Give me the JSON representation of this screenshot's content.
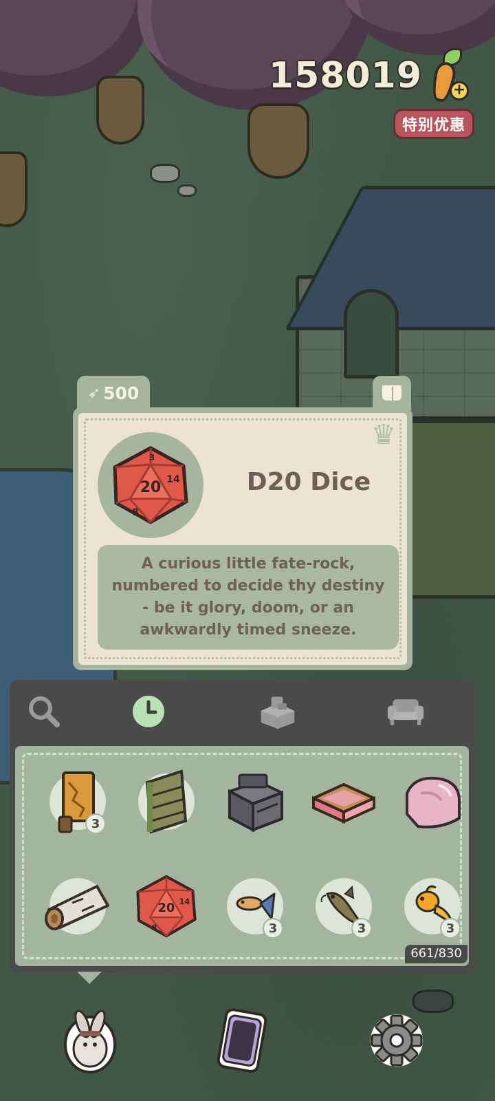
{
  "currency": {
    "amount": "158019",
    "icon": "carrot-plus-icon",
    "special_offer": "特别优惠"
  },
  "item_card": {
    "price": "500",
    "price_icon": "carrot-icon",
    "name": "D20 Dice",
    "description": "A curious little fate-rock, numbered to decide thy destiny - be it glory, doom, or an awkwardly timed sneeze.",
    "die_faces": [
      "20",
      "14",
      "8",
      "3"
    ]
  },
  "inventory": {
    "tabs": [
      {
        "icon": "magnifier-icon",
        "active": false
      },
      {
        "icon": "clock-icon",
        "active": true
      },
      {
        "icon": "appliance-icon",
        "active": false
      },
      {
        "icon": "sofa-icon",
        "active": false
      }
    ],
    "items": [
      {
        "name": "ornate-screen",
        "count": "3"
      },
      {
        "name": "wooden-shelf",
        "count": ""
      },
      {
        "name": "photocopier",
        "count": ""
      },
      {
        "name": "flower-planter",
        "count": ""
      },
      {
        "name": "pink-rock",
        "count": ""
      },
      {
        "name": "birch-log",
        "count": ""
      },
      {
        "name": "d20-dice",
        "count": ""
      },
      {
        "name": "guppy-fish",
        "count": "3"
      },
      {
        "name": "catfish",
        "count": "3"
      },
      {
        "name": "goldfish",
        "count": "3"
      }
    ],
    "capacity": "661/830"
  },
  "bottom_nav": [
    {
      "icon": "bunny-avatar-icon"
    },
    {
      "icon": "phone-icon"
    },
    {
      "icon": "settings-gear-icon"
    }
  ],
  "colors": {
    "card_frame": "#a4b49e",
    "card_bg": "#ece3d3",
    "panel_dark": "#4a4a4a",
    "active_tab": "#b9e2b5",
    "offer_badge": "#b8545b"
  }
}
